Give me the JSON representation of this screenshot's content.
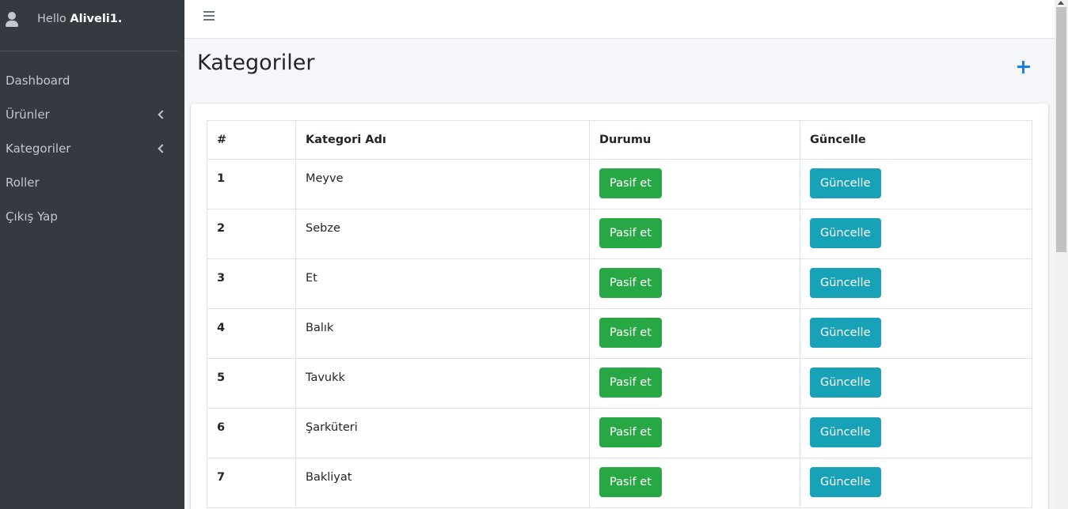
{
  "user": {
    "greeting": "Hello",
    "name": "Aliveli1."
  },
  "sidebar": {
    "items": [
      {
        "label": "Dashboard",
        "has_submenu": false
      },
      {
        "label": "Ürünler",
        "has_submenu": true
      },
      {
        "label": "Kategoriler",
        "has_submenu": true
      },
      {
        "label": "Roller",
        "has_submenu": false
      },
      {
        "label": "Çıkış Yap",
        "has_submenu": false
      }
    ]
  },
  "page": {
    "title": "Kategoriler",
    "add_icon": "plus-icon"
  },
  "table": {
    "headers": [
      "#",
      "Kategori Adı",
      "Durumu",
      "Güncelle"
    ],
    "rows": [
      {
        "id": "1",
        "name": "Meyve",
        "status_button": "Pasif et",
        "update_button": "Güncelle"
      },
      {
        "id": "2",
        "name": "Sebze",
        "status_button": "Pasif et",
        "update_button": "Güncelle"
      },
      {
        "id": "3",
        "name": "Et",
        "status_button": "Pasif et",
        "update_button": "Güncelle"
      },
      {
        "id": "4",
        "name": "Balık",
        "status_button": "Pasif et",
        "update_button": "Güncelle"
      },
      {
        "id": "5",
        "name": "Tavukk",
        "status_button": "Pasif et",
        "update_button": "Güncelle"
      },
      {
        "id": "6",
        "name": "Şarküteri",
        "status_button": "Pasif et",
        "update_button": "Güncelle"
      },
      {
        "id": "7",
        "name": "Bakliyat",
        "status_button": "Pasif et",
        "update_button": "Güncelle"
      }
    ]
  },
  "colors": {
    "sidebar_bg": "#343a40",
    "success": "#28a745",
    "info": "#17a2b8",
    "accent": "#1f7aec"
  }
}
